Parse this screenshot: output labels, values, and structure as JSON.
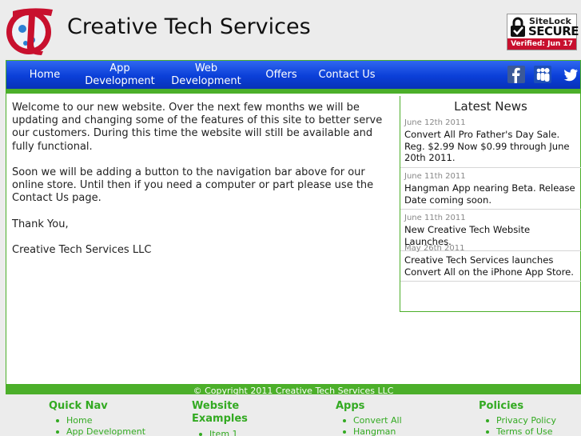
{
  "header": {
    "site_title": "Creative Tech Services",
    "sitelock": {
      "top": "SiteLock",
      "secure": "SECURE",
      "verified": "Verified: Jun 17"
    }
  },
  "nav": {
    "home": "Home",
    "app_line1": "App",
    "app_line2": "Development",
    "web_line1": "Web",
    "web_line2": "Development",
    "offers": "Offers",
    "contact": "Contact Us",
    "social": [
      "facebook-icon",
      "myspace-icon",
      "twitter-icon"
    ]
  },
  "main": {
    "paragraphs": [
      "Welcome to our new website. Over the next few months we will be updating and changing some of the features of this site to better serve our customers. During this time the website will still be available and fully functional.",
      "Soon we will be adding a button to the navigation bar above for our online store. Until then if you need a computer or part please use the Contact Us page.",
      "Thank You,",
      "Creative Tech Services LLC"
    ]
  },
  "news": {
    "title": "Latest News",
    "items": [
      {
        "date": "June 12th 2011",
        "text": "Convert All Pro Father's Day Sale. Reg. $2.99 Now $0.99 through June 20th 2011."
      },
      {
        "date": "June 11th 2011",
        "text": "Hangman App nearing Beta. Release Date coming soon."
      },
      {
        "date": "June 11th 2011",
        "text": "New Creative Tech Website Launches."
      },
      {
        "date": "May 26th 2011",
        "text": "Creative Tech Services launches Convert All on the iPhone App Store."
      }
    ]
  },
  "footer": {
    "copyright": "© Copyright 2011 Creative Tech Services LLC",
    "columns": [
      {
        "title": "Quick Nav",
        "items": [
          "Home",
          "App Development"
        ]
      },
      {
        "title": "Website Examples",
        "items": [
          "Item 1"
        ]
      },
      {
        "title": "Apps",
        "items": [
          "Convert All",
          "Hangman"
        ]
      },
      {
        "title": "Policies",
        "items": [
          "Privacy Policy",
          "Terms of Use"
        ]
      }
    ]
  },
  "colors": {
    "nav_blue": "#0b3fd8",
    "accent_green": "#4caf2a",
    "link_green": "#33aa22",
    "sitelock_red": "#c8102e"
  }
}
